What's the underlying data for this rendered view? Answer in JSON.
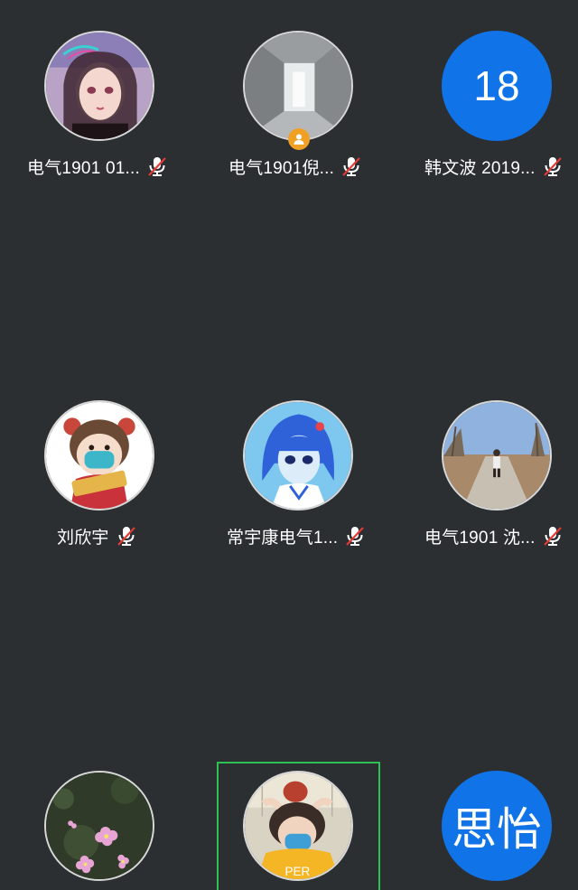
{
  "participants": [
    {
      "name": "电气1901 01...",
      "avatar": "anime-girl-portrait",
      "muted": true
    },
    {
      "name": "电气1901倪...",
      "avatar": "hallway-photo",
      "muted": true,
      "host": true
    },
    {
      "name": "韩文波 2019...",
      "avatar_text": "18",
      "muted": true
    },
    {
      "name": "刘欣宇",
      "avatar": "cartoon-girl-mask",
      "muted": true
    },
    {
      "name": "常宇康电气1...",
      "avatar": "anime-blue-hair",
      "muted": true
    },
    {
      "name": "电气1901  沈...",
      "avatar": "outdoor-road-photo",
      "muted": true
    },
    {
      "name": "",
      "avatar": "pink-flowers-photo"
    },
    {
      "name": "",
      "avatar": "person-with-mask",
      "selected": true
    },
    {
      "name": "",
      "avatar_text": "思怡"
    }
  ],
  "colors": {
    "background": "#2b2f31",
    "initials_bg": "#1173e8",
    "selected_border": "#2fbf52",
    "host_badge": "#f0a024",
    "mic_muted_slash": "#e53935"
  }
}
